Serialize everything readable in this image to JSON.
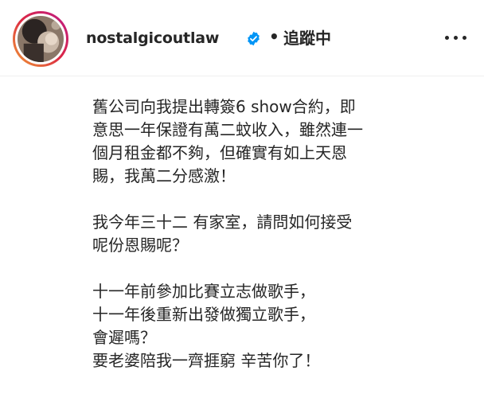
{
  "post": {
    "username": "nostalgicoutlaw",
    "separator": "•",
    "follow_status": "追蹤中"
  },
  "icons": {
    "verified": "verified-badge-icon",
    "more": "more-options-icon",
    "avatar": "profile-photo"
  },
  "colors": {
    "verified_blue": "#0095f6",
    "text": "#262626",
    "divider": "#efefef"
  },
  "caption": {
    "para1": [
      "舊公司向我提出轉簽6 show合約，即",
      "意思一年保證有萬二蚊收入，雖然連一",
      "個月租金都不夠，但確實有如上天恩",
      "賜，我萬二分感激！"
    ],
    "para2": [
      "我今年三十二 有家室，請問如何接受",
      "呢份恩賜呢？"
    ],
    "para3": [
      "十一年前參加比賽立志做歌手，",
      "十一年後重新出發做獨立歌手，",
      "會遲嗎？",
      "要老婆陪我一齊捱窮 辛苦你了！"
    ]
  }
}
